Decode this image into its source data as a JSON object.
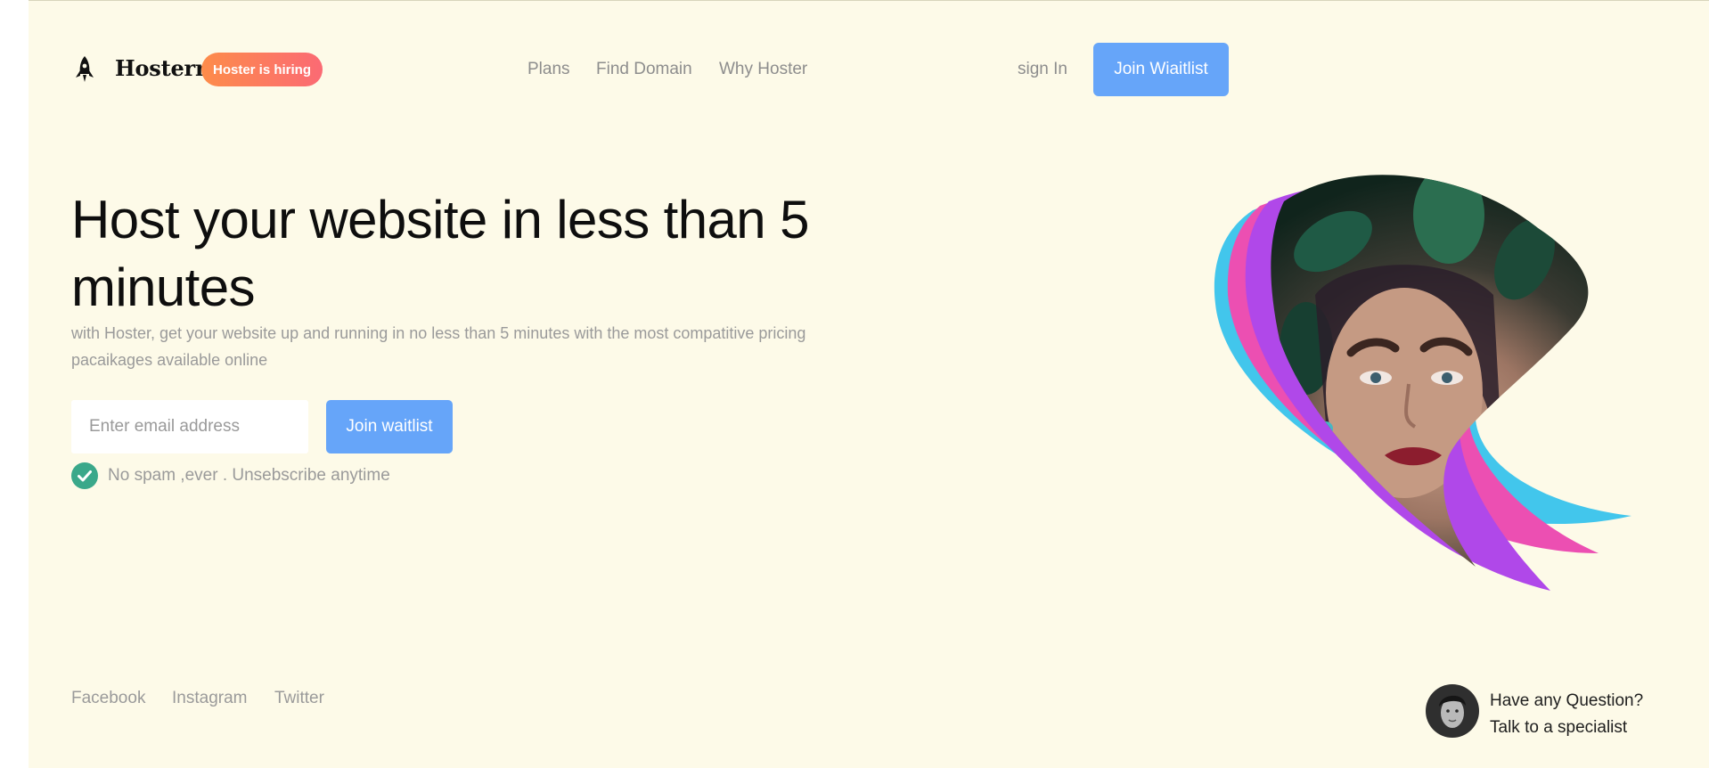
{
  "header": {
    "brand": "Hosterr",
    "badge": "Hoster is hiring",
    "nav": [
      {
        "label": "Plans"
      },
      {
        "label": "Find Domain"
      },
      {
        "label": "Why Hoster"
      }
    ],
    "signin": "sign In",
    "cta": "Join Wiaitlist"
  },
  "hero": {
    "title_line1": "Host your website in less than 5",
    "title_line2": "minutes",
    "subtitle_line1": "with Hoster, get your website up and running in no less than 5 minutes with the most compatitive pricing",
    "subtitle_line2": "pacaikages available online",
    "email_placeholder": "Enter email address",
    "email_value": "",
    "join_label": "Join waitlist",
    "note": "No spam ,ever . Unsebscribe anytime"
  },
  "footer": {
    "social": [
      {
        "label": "Facebook"
      },
      {
        "label": "Instagram"
      },
      {
        "label": "Twitter"
      }
    ],
    "question_line1": "Have any Question?",
    "question_line2": "Talk to a specialist"
  },
  "icons": {
    "logo": "rocket-icon",
    "note": "check-circle-icon",
    "avatar": "specialist-avatar"
  },
  "colors": {
    "background": "#fdfae8",
    "accent_blue": "#66a5f9",
    "badge_start": "#fd8c4a",
    "badge_end": "#fb6a74",
    "check_green": "#3aa88a",
    "shape_cyan": "#42c6ec",
    "shape_pink": "#ec4fb2",
    "shape_purple": "#b048e9"
  }
}
